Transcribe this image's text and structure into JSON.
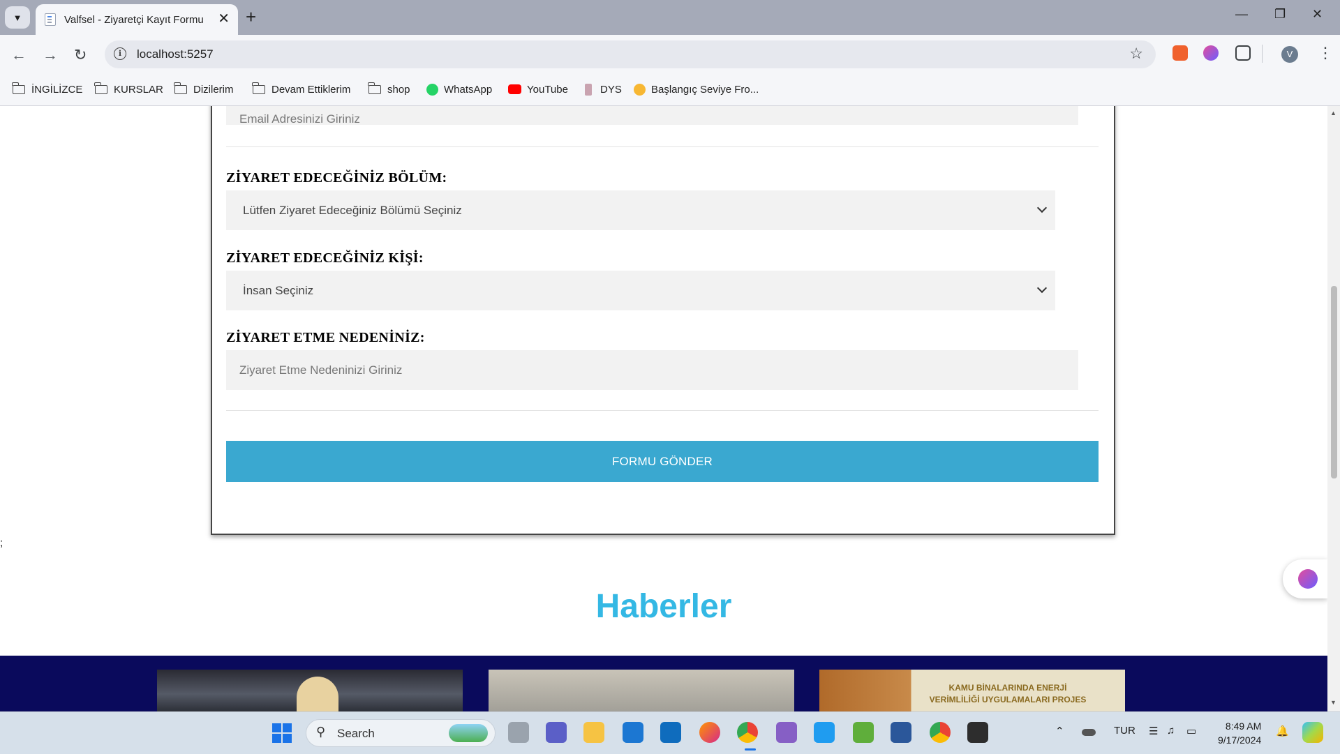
{
  "browser": {
    "tab_title": "Valfsel - Ziyaretçi Kayıt Formu",
    "url": "localhost:5257",
    "avatar_letter": "V",
    "bookmarks": [
      {
        "label": "İNGİLİZCE",
        "icon": "folder-icon"
      },
      {
        "label": "KURSLAR",
        "icon": "folder-icon"
      },
      {
        "label": "Dizilerim",
        "icon": "folder-icon"
      },
      {
        "label": "Devam Ettiklerim",
        "icon": "folder-icon"
      },
      {
        "label": "shop",
        "icon": "folder-icon"
      },
      {
        "label": "WhatsApp",
        "icon": "whatsapp-icon"
      },
      {
        "label": "YouTube",
        "icon": "youtube-icon"
      },
      {
        "label": "DYS",
        "icon": "dys-icon"
      },
      {
        "label": "Başlangıç Seviye Fro...",
        "icon": "site-icon"
      }
    ]
  },
  "form": {
    "email_placeholder": "Email Adresinizi Giriniz",
    "bolum_label": "ZİYARET EDECEĞİNİZ BÖLÜM:",
    "bolum_selected": "Lütfen Ziyaret Edeceğiniz Bölümü Seçiniz",
    "kisi_label": "ZİYARET EDECEĞİNİZ KİŞİ:",
    "kisi_selected": "İnsan Seçiniz",
    "neden_label": "ZİYARET ETME NEDENİNİZ:",
    "neden_placeholder": "Ziyaret Etme Nedeninizi Giriniz",
    "submit_label": "FORMU GÖNDER"
  },
  "stray_text": ";",
  "news": {
    "heading": "Haberler",
    "card3_caption_line1": "KAMU BİNALARINDA ENERJİ",
    "card3_caption_line2": "VERİMLİLİĞİ UYGULAMALARI PROJES"
  },
  "taskbar": {
    "search_label": "Search",
    "language": "TUR",
    "time": "8:49 AM",
    "date": "9/17/2024"
  },
  "colors": {
    "accent_button": "#3aa8d0",
    "heading": "#34b8e4",
    "news_band": "#0a0a5c"
  }
}
